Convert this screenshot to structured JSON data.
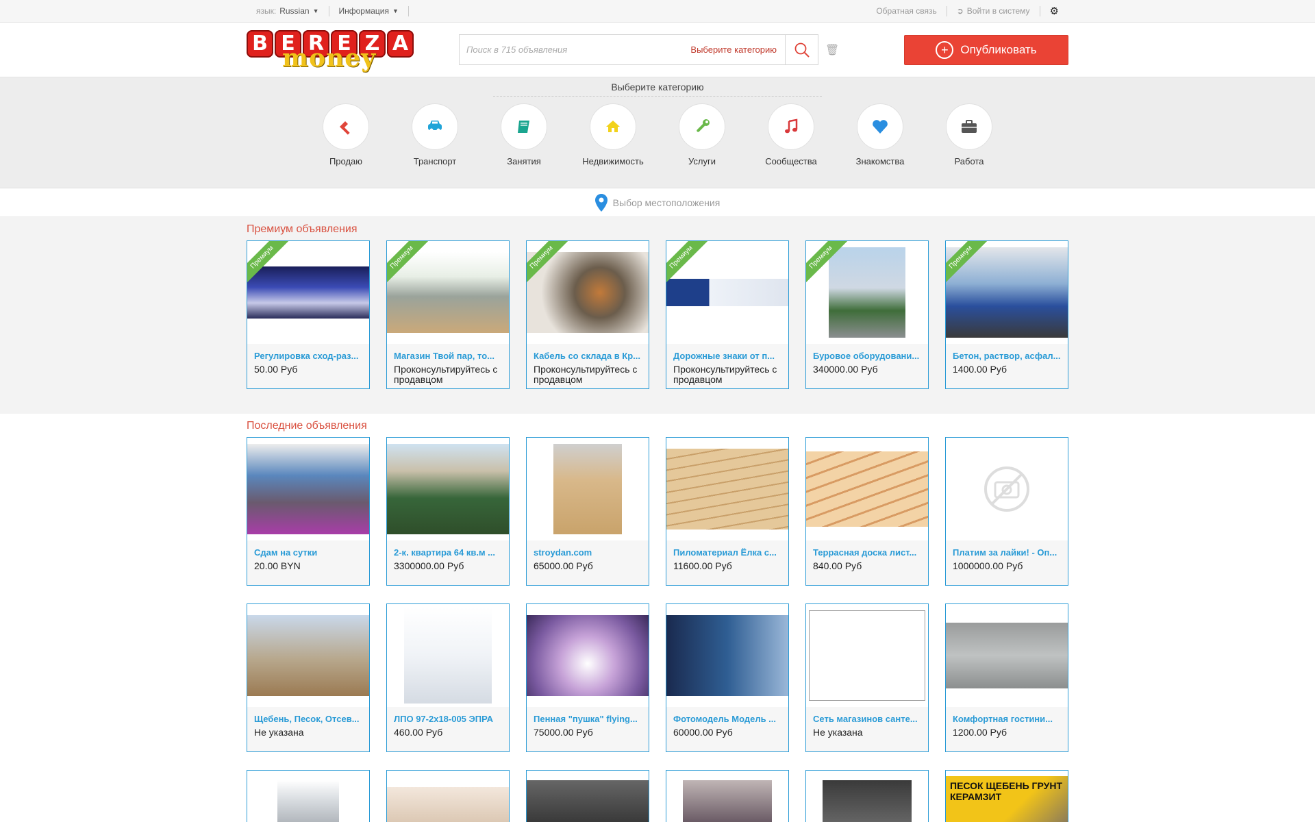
{
  "topbar": {
    "lang_label": "язык:",
    "lang_value": "Russian",
    "info": "Информация",
    "feedback": "Обратная связь",
    "login": "Войти в систему"
  },
  "logo": {
    "letters": [
      "B",
      "E",
      "R",
      "E",
      "Z",
      "A"
    ],
    "sub": "money"
  },
  "search": {
    "placeholder": "Поиск в 715 объявления",
    "category": "Выберите категорию"
  },
  "publish_label": "Опубликовать",
  "categories": {
    "title": "Выберите категорию",
    "items": [
      {
        "label": "Продаю",
        "icon": "gavel-icon",
        "color": "#e0453a"
      },
      {
        "label": "Транспорт",
        "icon": "car-icon",
        "color": "#20a4d8"
      },
      {
        "label": "Занятия",
        "icon": "book-icon",
        "color": "#1aa58f"
      },
      {
        "label": "Недвижимость",
        "icon": "home-icon",
        "color": "#f2d21b"
      },
      {
        "label": "Услуги",
        "icon": "wrench-icon",
        "color": "#6ab94a"
      },
      {
        "label": "Сообщества",
        "icon": "music-icon",
        "color": "#d9383a"
      },
      {
        "label": "Знакомства",
        "icon": "heart-icon",
        "color": "#2a8ee0"
      },
      {
        "label": "Работа",
        "icon": "briefcase-icon",
        "color": "#555555"
      }
    ]
  },
  "location_placeholder": "Выбор местоположения",
  "premium": {
    "title": "Премиум объявления",
    "ribbon": "Премиум",
    "items": [
      {
        "title": "Регулировка сход-раз...",
        "price": "50.00 Руб"
      },
      {
        "title": "Магазин Твой пар, то...",
        "price": "Проконсультируйтесь с продавцом"
      },
      {
        "title": "Кабель со склада в Кр...",
        "price": "Проконсультируйтесь с продавцом"
      },
      {
        "title": "Дорожные знаки от п...",
        "price": "Проконсультируйтесь с продавцом"
      },
      {
        "title": "Буровое оборудовани...",
        "price": "340000.00 Руб"
      },
      {
        "title": "Бетон, раствор, асфал...",
        "price": "1400.00 Руб"
      }
    ]
  },
  "latest": {
    "title": "Последние объявления",
    "rows": [
      [
        {
          "title": "Сдам на сутки",
          "price": "20.00 BYN"
        },
        {
          "title": "2-к. квартира 64 кв.м ...",
          "price": "3300000.00 Руб"
        },
        {
          "title": "stroydan.com",
          "price": "65000.00 Руб"
        },
        {
          "title": "Пиломатериал Ёлка с...",
          "price": "11600.00 Руб"
        },
        {
          "title": "Террасная доска лист...",
          "price": "840.00 Руб"
        },
        {
          "title": "Платим за лайки! - Оп...",
          "price": "1000000.00 Руб"
        }
      ],
      [
        {
          "title": "Щебень, Песок, Отсев...",
          "price": "Не указана"
        },
        {
          "title": "ЛПО 97-2х18-005 ЭПРА",
          "price": "460.00 Руб"
        },
        {
          "title": "Пенная \"пушка\" flying...",
          "price": "75000.00 Руб"
        },
        {
          "title": "Фотомодель Модель ...",
          "price": "60000.00 Руб"
        },
        {
          "title": "Сеть магазинов санте...",
          "price": "Не указана"
        },
        {
          "title": "Комфортная гостини...",
          "price": "1200.00 Руб"
        }
      ]
    ],
    "partial_images": [
      "ПЕСОК ЩЕБЕНЬ ГРУНТ КЕРАМЗИТ"
    ]
  }
}
